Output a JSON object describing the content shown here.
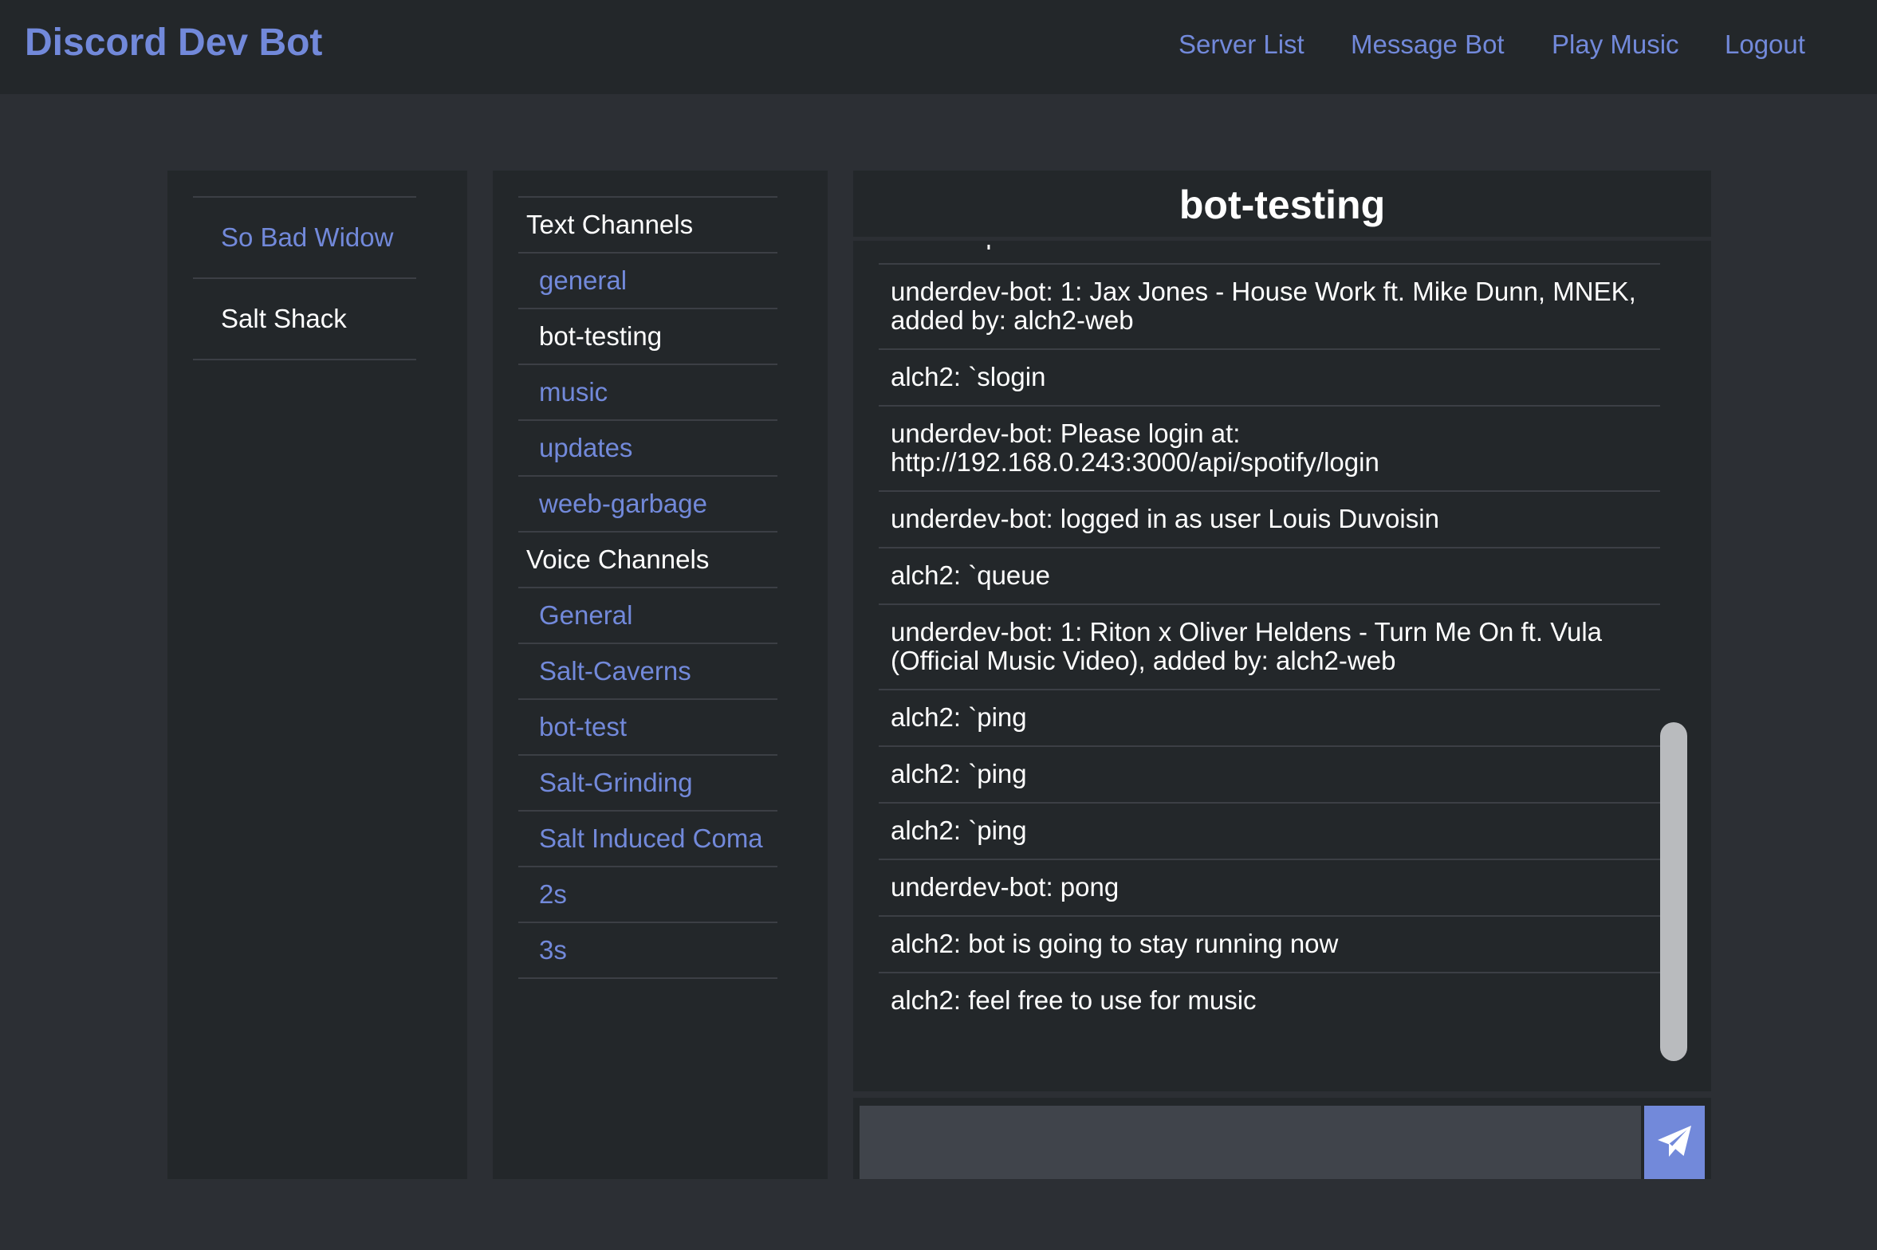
{
  "navbar": {
    "brand": "Discord Dev Bot",
    "links": [
      "Server List",
      "Message Bot",
      "Play Music",
      "Logout"
    ]
  },
  "servers": [
    {
      "name": "So Bad Widow",
      "active": false
    },
    {
      "name": "Salt Shack",
      "active": true
    }
  ],
  "channels": {
    "text_header": "Text Channels",
    "text": [
      {
        "name": "general",
        "active": false
      },
      {
        "name": "bot-testing",
        "active": true
      },
      {
        "name": "music",
        "active": false
      },
      {
        "name": "updates",
        "active": false
      },
      {
        "name": "weeb-garbage",
        "active": false
      }
    ],
    "voice_header": "Voice Channels",
    "voice": [
      "General",
      "Salt-Caverns",
      "bot-test",
      "Salt-Grinding",
      "Salt Induced Coma",
      "2s",
      "3s"
    ]
  },
  "chat": {
    "title": "bot-testing",
    "messages": [
      "alch2: `queue",
      "underdev-bot: 1: Jax Jones - House Work ft. Mike Dunn, MNEK, added by: alch2-web",
      "alch2: `slogin",
      "underdev-bot: Please login at: http://192.168.0.243:3000/api/spotify/login",
      "underdev-bot: logged in as user Louis Duvoisin",
      "alch2: `queue",
      "underdev-bot: 1: Riton x Oliver Heldens - Turn Me On ft. Vula (Official Music Video), added by: alch2-web",
      "alch2: `ping",
      "alch2: `ping",
      "alch2: `ping",
      "underdev-bot: pong",
      "alch2: bot is going to stay running now",
      "alch2: feel free to use for music"
    ],
    "input_value": "",
    "send_icon": "paper-plane-icon"
  },
  "colors": {
    "accent": "#7289da",
    "background": "#2c2f34",
    "panel": "#23272a",
    "input": "#40444b"
  }
}
